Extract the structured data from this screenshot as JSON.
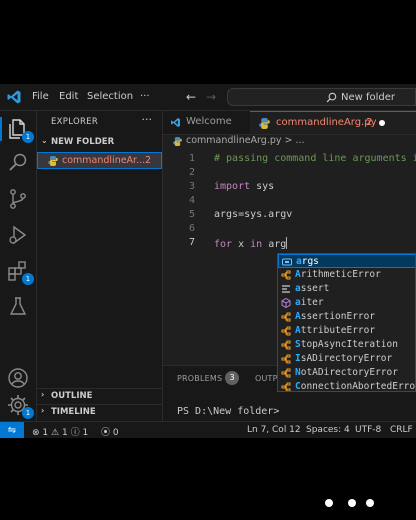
{
  "menu": {
    "file": "File",
    "edit": "Edit",
    "selection": "Selection",
    "more": "···"
  },
  "command_center": {
    "text": "New folder"
  },
  "explorer": {
    "title": "EXPLORER",
    "more": "···",
    "folder": "NEW FOLDER",
    "file": {
      "name": "commandlineAr...",
      "problems": "2"
    },
    "outline": "OUTLINE",
    "timeline": "TIMELINE"
  },
  "activity": {
    "explorer_badge": "1",
    "accounts_badge": "1",
    "extensions_badge": "1"
  },
  "tabs": [
    {
      "label": "Welcome"
    },
    {
      "label": "commandlineArg.py",
      "problems": "2"
    }
  ],
  "breadcrumb": "commandlineArg.py > ...",
  "editor": {
    "lines": [
      {
        "num": "1",
        "text": "# passing command line arguments in"
      },
      {
        "num": "2",
        "text": ""
      },
      {
        "num": "3",
        "kw": "import",
        "rest": " sys"
      },
      {
        "num": "4",
        "text": ""
      },
      {
        "num": "5",
        "text": "args=sys.argv"
      },
      {
        "num": "6",
        "text": ""
      },
      {
        "num": "7",
        "kw": "for",
        "rest": " x ",
        "kw2": "in",
        "rest2": " arg"
      }
    ]
  },
  "suggestions": [
    {
      "label": "args",
      "icon": "variable-icon"
    },
    {
      "label": "ArithmeticError",
      "icon": "class-icon"
    },
    {
      "label": "assert",
      "icon": "keyword-icon"
    },
    {
      "label": "aiter",
      "icon": "function-icon"
    },
    {
      "label": "AssertionError",
      "icon": "class-icon"
    },
    {
      "label": "AttributeError",
      "icon": "class-icon"
    },
    {
      "label": "StopAsyncIteration",
      "icon": "class-icon"
    },
    {
      "label": "IsADirectoryError",
      "icon": "class-icon"
    },
    {
      "label": "NotADirectoryError",
      "icon": "class-icon"
    },
    {
      "label": "ConnectionAbortedError",
      "icon": "class-icon"
    }
  ],
  "panel": {
    "problems": "PROBLEMS",
    "problems_count": "3",
    "output": "OUTPUT",
    "terminal": "PS D:\\New folder>"
  },
  "status": {
    "errors": "1",
    "warnings": "1",
    "info": "1",
    "ports": "0",
    "position": "Ln 7, Col 12",
    "spaces": "Spaces: 4",
    "encoding": "UTF-8",
    "eol": "CRLF"
  },
  "colors": {
    "accent": "#0078d4",
    "error": "#f48771",
    "comment": "#6a9955",
    "keyword": "#c586c0"
  }
}
